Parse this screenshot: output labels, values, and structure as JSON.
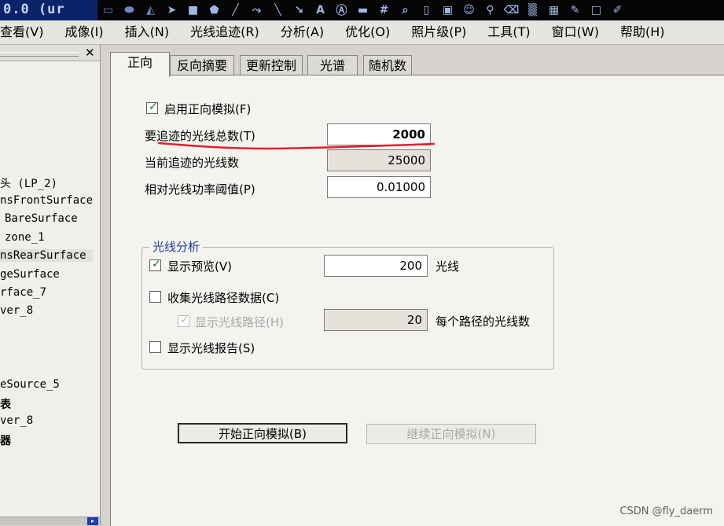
{
  "window": {
    "title_fragment": "0.0 (ur"
  },
  "toolbar": {
    "icons": [
      "rect-icon",
      "ellipse-icon",
      "plane-icon",
      "cursor-icon",
      "select-icon",
      "shape-icon",
      "pen-icon",
      "curve-icon",
      "line-icon",
      "arrow-icon",
      "text-icon",
      "text-box-icon",
      "comment-icon",
      "number-icon",
      "zoom-icon",
      "page-icon",
      "picture-icon",
      "emoji-icon",
      "stamp-icon",
      "eraser-icon",
      "hatch-icon",
      "grid-icon",
      "highlighter-icon",
      "box-icon",
      "edit-icon"
    ]
  },
  "menu": [
    "查看(V)",
    "成像(I)",
    "插入(N)",
    "光线追迹(R)",
    "分析(A)",
    "优化(O)",
    "照片级(P)",
    "工具(T)",
    "窗口(W)",
    "帮助(H)"
  ],
  "tree": {
    "items": [
      "头 (LP_2)",
      "nsFrontSurface",
      "BareSurface",
      "zone_1",
      "nsRearSurface",
      "geSurface",
      "rface_7",
      "ver_8",
      "eSource_5",
      "表",
      "ver_8",
      "器"
    ]
  },
  "tabs": [
    "正向",
    "反向摘要",
    "更新控制",
    "光谱",
    "随机数"
  ],
  "form": {
    "enable_forward": {
      "label": "启用正向模拟(F)",
      "checked": true
    },
    "total_rays": {
      "label": "要追迹的光线总数(T)",
      "value": "2000"
    },
    "current_rays": {
      "label": "当前追迹的光线数",
      "value": "25000"
    },
    "rel_threshold": {
      "label": "相对光线功率阈值(P)",
      "value": "0.01000"
    }
  },
  "ray_analysis": {
    "title": "光线分析",
    "show_preview": {
      "label": "显示预览(V)",
      "checked": true,
      "value": "200",
      "unit": "光线"
    },
    "collect_paths": {
      "label": "收集光线路径数据(C)",
      "checked": false
    },
    "show_paths": {
      "label": "显示光线路径(H)",
      "checked": true,
      "disabled": true,
      "value": "20",
      "unit": "每个路径的光线数"
    },
    "show_report": {
      "label": "显示光线报告(S)",
      "checked": false
    }
  },
  "buttons": {
    "start": "开始正向模拟(B)",
    "continue": "继续正向模拟(N)"
  },
  "watermark": "CSDN @fly_daerm",
  "colors": {
    "title_bar": "#0a246a",
    "group_title": "#1a3d9a",
    "annotation": "#e0202a"
  }
}
